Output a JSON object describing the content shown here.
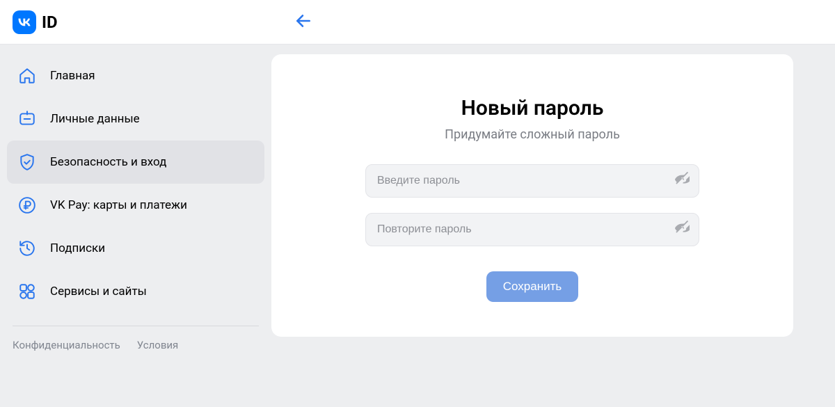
{
  "header": {
    "logo_short": "VK",
    "logo_text": "ID"
  },
  "sidebar": {
    "items": [
      {
        "label": "Главная"
      },
      {
        "label": "Личные данные"
      },
      {
        "label": "Безопасность и вход"
      },
      {
        "label": "VK Pay: карты и платежи"
      },
      {
        "label": "Подписки"
      },
      {
        "label": "Сервисы и сайты"
      }
    ],
    "footer": {
      "privacy": "Конфиденциальность",
      "terms": "Условия"
    }
  },
  "main": {
    "title": "Новый пароль",
    "subtitle": "Придумайте сложный пароль",
    "password_placeholder": "Введите пароль",
    "repeat_placeholder": "Повторите пароль",
    "save_label": "Сохранить"
  }
}
